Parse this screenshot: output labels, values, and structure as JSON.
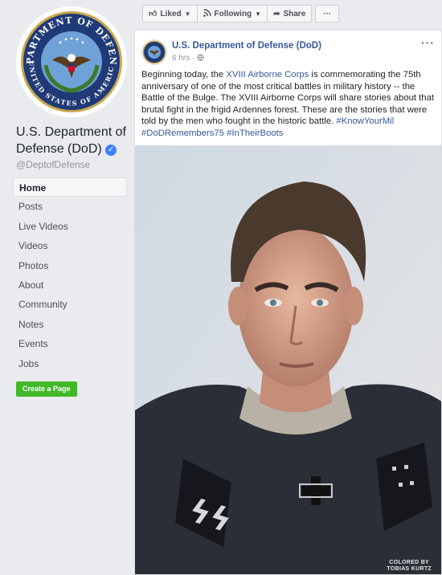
{
  "page": {
    "name": "U.S. Department of Defense (DoD)",
    "handle": "@DeptofDefense",
    "verified_icon": "verified-badge-icon",
    "logo": {
      "top_text": "DEPARTMENT OF DEFENSE",
      "bottom_text": "UNITED STATES OF AMERICA"
    }
  },
  "sidebar": {
    "items": [
      {
        "label": "Home",
        "active": true
      },
      {
        "label": "Posts"
      },
      {
        "label": "Live Videos"
      },
      {
        "label": "Videos"
      },
      {
        "label": "Photos"
      },
      {
        "label": "About"
      },
      {
        "label": "Community"
      },
      {
        "label": "Notes"
      },
      {
        "label": "Events"
      },
      {
        "label": "Jobs"
      }
    ],
    "create_page_label": "Create a Page"
  },
  "actions": {
    "liked_label": "Liked",
    "following_label": "Following",
    "share_label": "Share",
    "more_label": "···"
  },
  "post": {
    "author": "U.S. Department of Defense (DoD)",
    "time": "6 hrs",
    "menu_label": "···",
    "text": {
      "p1": "Beginning today, the ",
      "link1": "XVIII Airborne Corps",
      "p2": " is commemorating the 75th anniversary of one of the most critical battles in military history -- the Battle of the Bulge. The XVIII Airborne Corps will share stories about that brutal fight in the frigid Ardennes forest. These are the stories that were told by the men who fought in the historic battle. ",
      "tag1": "#KnowYourMil",
      "tag2": "#DoDRemembers75",
      "tag3": "#InTheirBoots"
    },
    "image_credit_line1": "COLORED BY",
    "image_credit_line2": "TOBIAS KURTZ"
  },
  "colors": {
    "accent": "#365899",
    "green": "#42b72a",
    "background": "#e9ebee"
  }
}
